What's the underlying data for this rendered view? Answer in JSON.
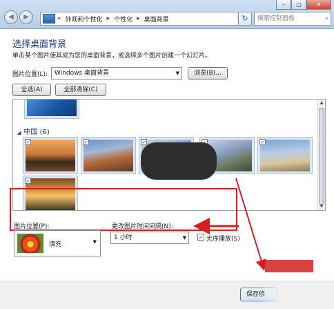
{
  "address_bar": {
    "chevron": "«",
    "crumbs": [
      "外观和个性化",
      "个性化",
      "桌面背景"
    ],
    "separator": "▸",
    "dropdown_icon": "▾",
    "refresh_icon": "↻"
  },
  "search": {
    "placeholder": "搜索控制面板",
    "icon": "search-icon"
  },
  "window_controls": {
    "minimize": "–",
    "maximize": "□",
    "close": "✕"
  },
  "page": {
    "title": "选择桌面背景",
    "description": "单击某个图片使其成为您的桌面背景，或选择多个图片创建一个幻灯片。"
  },
  "picture_location": {
    "label": "图片位置(L):",
    "value": "Windows 桌面背景",
    "browse": "浏览(B)..."
  },
  "selection_buttons": {
    "select_all": "全选(A)",
    "clear_all": "全部清除(C)"
  },
  "gallery": {
    "group_title": "中国 (6)",
    "check_mark": "✓",
    "items": [
      {
        "name": "china-sunset-river",
        "checked": true
      },
      {
        "name": "great-wall",
        "checked": true
      },
      {
        "name": "china-obscured",
        "checked": true
      },
      {
        "name": "china-mountain-lake",
        "checked": true
      },
      {
        "name": "china-beach-rocks",
        "checked": true
      },
      {
        "name": "china-bridge",
        "checked": true
      }
    ]
  },
  "options": {
    "position_label": "图片位置(P):",
    "position_value": "填充",
    "interval_label": "更改图片时间间隔(N):",
    "interval_value": "1 小时",
    "shuffle_label": "无序播放(S)",
    "shuffle_checked": true
  },
  "footer": {
    "save_label": "保存修"
  },
  "colors": {
    "accent": "#1e3287",
    "annotation": "#d42020"
  }
}
